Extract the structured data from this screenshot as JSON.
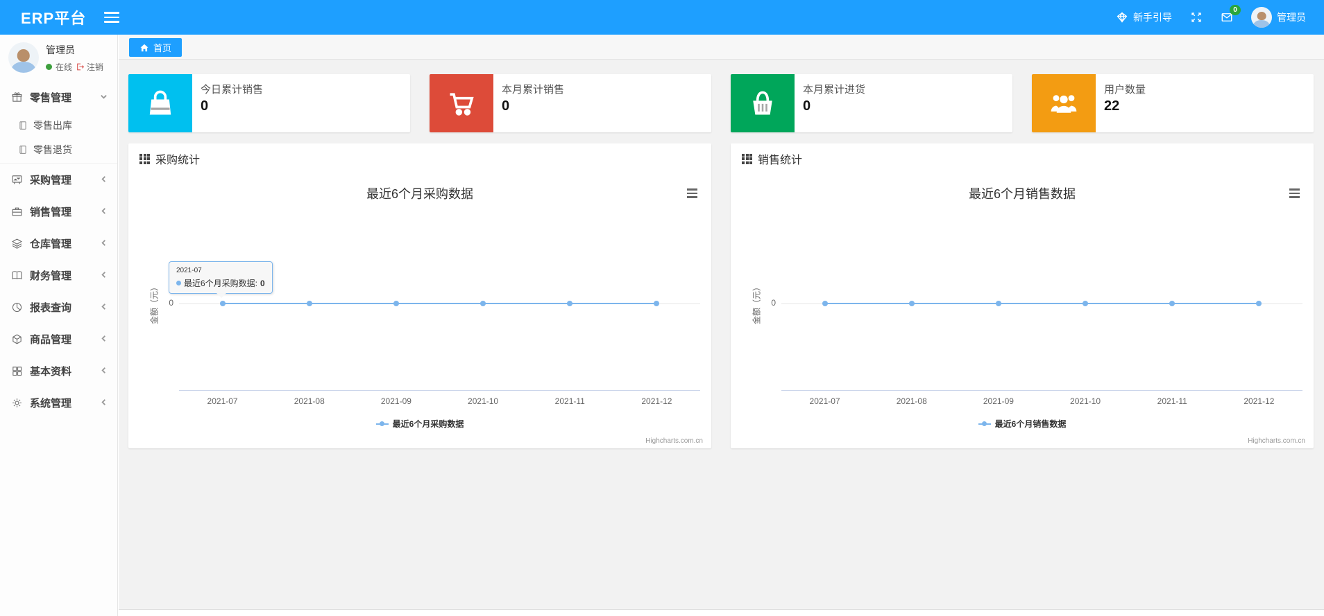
{
  "navbar": {
    "brand": "ERP平台",
    "guide_label": "新手引导",
    "mail_badge": "0",
    "badge_color": "#2aa63c",
    "username": "管理员",
    "bar_color": "#1e9fff"
  },
  "sidebar": {
    "user": {
      "name": "管理员",
      "status": "在线",
      "status_color": "#3d9f3d",
      "logout_label": "注销"
    },
    "menu": [
      {
        "icon": "gift-icon",
        "label": "零售管理",
        "state": "expanded",
        "children": [
          {
            "icon": "notebook-icon",
            "label": "零售出库"
          },
          {
            "icon": "notebook-icon",
            "label": "零售退货"
          }
        ]
      },
      {
        "icon": "procurement-icon",
        "label": "采购管理",
        "state": "collapsed"
      },
      {
        "icon": "briefcase-icon",
        "label": "销售管理",
        "state": "collapsed"
      },
      {
        "icon": "layers-icon",
        "label": "仓库管理",
        "state": "collapsed"
      },
      {
        "icon": "finance-book-icon",
        "label": "财务管理",
        "state": "collapsed"
      },
      {
        "icon": "pie-chart-icon",
        "label": "报表查询",
        "state": "collapsed"
      },
      {
        "icon": "package-icon",
        "label": "商品管理",
        "state": "collapsed"
      },
      {
        "icon": "grid-icon",
        "label": "基本资料",
        "state": "collapsed"
      },
      {
        "icon": "gear-icon",
        "label": "系统管理",
        "state": "collapsed"
      }
    ]
  },
  "tabbar": {
    "active_tab": "首页"
  },
  "cards": [
    {
      "icon": "shopping-bag-icon",
      "color": "#00c0ef",
      "label": "今日累计销售",
      "value": "0"
    },
    {
      "icon": "cart-icon",
      "color": "#dd4b39",
      "label": "本月累计销售",
      "value": "0"
    },
    {
      "icon": "basket-icon",
      "color": "#00a65a",
      "label": "本月累计进货",
      "value": "0"
    },
    {
      "icon": "users-icon",
      "color": "#f39c12",
      "label": "用户数量",
      "value": "22"
    }
  ],
  "panels": [
    {
      "header": "采购统计"
    },
    {
      "header": "销售统计"
    }
  ],
  "chart_data": [
    {
      "type": "line",
      "title": "最近6个月采购数据",
      "categories": [
        "2021-07",
        "2021-08",
        "2021-09",
        "2021-10",
        "2021-11",
        "2021-12"
      ],
      "series": [
        {
          "name": "最近6个月采购数据",
          "values": [
            0,
            0,
            0,
            0,
            0,
            0
          ],
          "color": "#7cb5ec"
        }
      ],
      "xlabel": "",
      "ylabel": "金额（元）",
      "yticks": [
        "0"
      ],
      "ylim": [
        -1,
        1
      ],
      "grid": "zero-line-only",
      "legend_position": "bottom",
      "credit": "Highcharts.com.cn",
      "tooltip": {
        "visible": true,
        "header": "2021-07",
        "series_label": "最近6个月采购数据:",
        "value": "0"
      }
    },
    {
      "type": "line",
      "title": "最近6个月销售数据",
      "categories": [
        "2021-07",
        "2021-08",
        "2021-09",
        "2021-10",
        "2021-11",
        "2021-12"
      ],
      "series": [
        {
          "name": "最近6个月销售数据",
          "values": [
            0,
            0,
            0,
            0,
            0,
            0
          ],
          "color": "#7cb5ec"
        }
      ],
      "xlabel": "",
      "ylabel": "金额（元）",
      "yticks": [
        "0"
      ],
      "ylim": [
        -1,
        1
      ],
      "grid": "zero-line-only",
      "legend_position": "bottom",
      "credit": "Highcharts.com.cn",
      "tooltip": {
        "visible": false
      }
    }
  ]
}
